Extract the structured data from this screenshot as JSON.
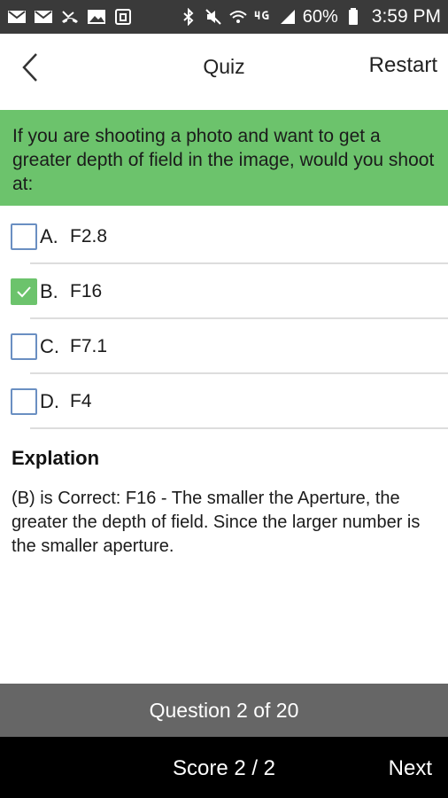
{
  "status_bar": {
    "battery_percent": "60%",
    "time": "3:59 PM",
    "left_icons": [
      "email-icon",
      "email-icon",
      "missed-call-icon",
      "image-icon",
      "calendar-icon"
    ],
    "right_icons": [
      "bluetooth-icon",
      "mute-icon",
      "wifi-icon",
      "4g-icon",
      "signal-icon",
      "battery-icon"
    ]
  },
  "header": {
    "title": "Quiz",
    "restart_label": "Restart"
  },
  "question": {
    "text": "If you are shooting a photo and want to get a greater depth of field in the image, would you shoot at:"
  },
  "options": [
    {
      "letter": "A.",
      "text": "F2.8",
      "checked": false
    },
    {
      "letter": "B.",
      "text": "F16",
      "checked": true
    },
    {
      "letter": "C.",
      "text": "F7.1",
      "checked": false
    },
    {
      "letter": "D.",
      "text": "F4",
      "checked": false
    }
  ],
  "explanation": {
    "title": "Explation",
    "body": "(B) is Correct: F16 - The smaller the Aperture, the greater the depth of field. Since the larger number is the smaller aperture."
  },
  "progress": {
    "label": "Question 2 of 20"
  },
  "footer": {
    "score_label": "Score 2 / 2",
    "next_label": "Next"
  },
  "colors": {
    "accent_green": "#6cc36c",
    "status_bar": "#3a3a3a",
    "progress_bar": "#666666",
    "footer": "#000000"
  }
}
